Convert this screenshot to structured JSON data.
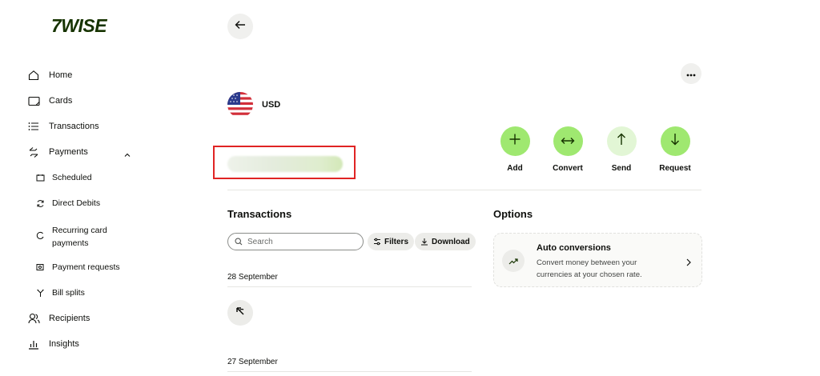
{
  "brand": {
    "logo_text": "7WISE",
    "accent": "#9fe870",
    "dark_green": "#163300"
  },
  "sidebar": {
    "items": [
      {
        "label": "Home",
        "icon": "home-icon"
      },
      {
        "label": "Cards",
        "icon": "card-icon"
      },
      {
        "label": "Transactions",
        "icon": "list-icon"
      },
      {
        "label": "Payments",
        "icon": "payments-icon",
        "expanded": true
      },
      {
        "label": "Recipients",
        "icon": "recipients-icon"
      },
      {
        "label": "Insights",
        "icon": "insights-icon"
      }
    ],
    "payments_sub": [
      {
        "label": "Scheduled",
        "icon": "calendar-icon"
      },
      {
        "label": "Direct Debits",
        "icon": "refresh-icon"
      },
      {
        "label_line1": "Recurring card",
        "label_line2": "payments",
        "icon": "recurring-icon"
      },
      {
        "label": "Payment requests",
        "icon": "request-icon"
      },
      {
        "label": "Bill splits",
        "icon": "split-icon"
      }
    ]
  },
  "account": {
    "currency": "USD",
    "flag": "us-flag-icon"
  },
  "actions": [
    {
      "label": "Add",
      "icon": "plus-icon"
    },
    {
      "label": "Convert",
      "icon": "convert-icon"
    },
    {
      "label": "Send",
      "icon": "arrow-up-icon"
    },
    {
      "label": "Request",
      "icon": "arrow-down-icon"
    }
  ],
  "transactions": {
    "title": "Transactions",
    "search_placeholder": "Search",
    "filters_label": "Filters",
    "download_label": "Download",
    "groups": [
      {
        "date": "28 September"
      },
      {
        "date": "27 September"
      }
    ]
  },
  "options": {
    "title": "Options",
    "card": {
      "title": "Auto conversions",
      "desc_line1": "Convert money between your",
      "desc_line2": "currencies at your chosen rate."
    }
  }
}
